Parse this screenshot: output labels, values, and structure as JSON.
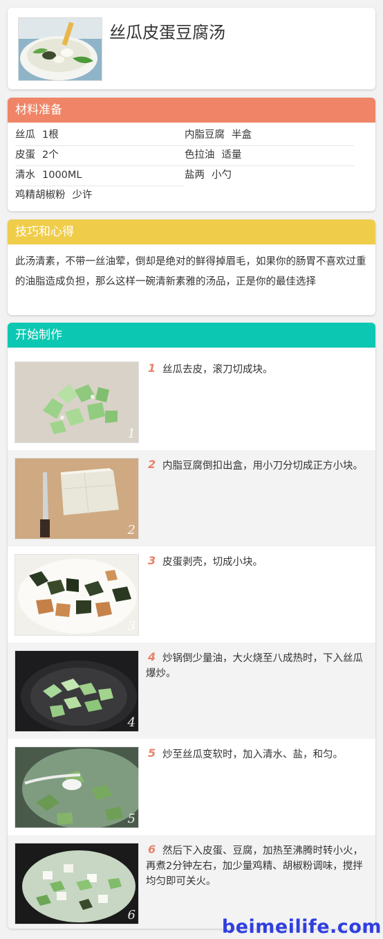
{
  "title": "丝瓜皮蛋豆腐汤",
  "ingredients": {
    "heading": "材料准备",
    "items": [
      {
        "name": "丝瓜",
        "amount": "1根"
      },
      {
        "name": "内脂豆腐",
        "amount": "半盒"
      },
      {
        "name": "皮蛋",
        "amount": "2个"
      },
      {
        "name": "色拉油",
        "amount": "适量"
      },
      {
        "name": "清水",
        "amount": "1000ML"
      },
      {
        "name": "盐两",
        "amount": "小勺"
      },
      {
        "name": "鸡精胡椒粉",
        "amount": "少许"
      }
    ]
  },
  "tips": {
    "heading": "技巧和心得",
    "text": "此汤清素，不带一丝油荤，倒却是绝对的鲜得掉眉毛，如果你的肠胃不喜欢过重的油脂造成负担，那么这样一碗清新素雅的汤品，正是你的最佳选择"
  },
  "steps": {
    "heading": "开始制作",
    "items": [
      {
        "num": "1",
        "text": "丝瓜去皮，滚刀切成块。",
        "img_num": "1"
      },
      {
        "num": "2",
        "text": "内脂豆腐倒扣出盒，用小刀分切成正方小块。",
        "img_num": "2"
      },
      {
        "num": "3",
        "text": "皮蛋剥壳，切成小块。",
        "img_num": "3"
      },
      {
        "num": "4",
        "text": "炒锅倒少量油，大火烧至八成热时，下入丝瓜爆炒。",
        "img_num": "4"
      },
      {
        "num": "5",
        "text": "炒至丝瓜变软时，加入清水、盐，和匀。",
        "img_num": "5"
      },
      {
        "num": "6",
        "text": "然后下入皮蛋、豆腐，加热至沸腾时转小火，再煮2分钟左右，加少量鸡精、胡椒粉调味，搅拌均匀即可关火。",
        "img_num": "6"
      }
    ]
  },
  "watermark": "beimeilife.com",
  "colors": {
    "ingredients_header": "#ef8566",
    "tips_header": "#efcd4a",
    "steps_header": "#0cc8b2",
    "step_number": "#e8826a",
    "watermark": "#2f3fe0"
  }
}
